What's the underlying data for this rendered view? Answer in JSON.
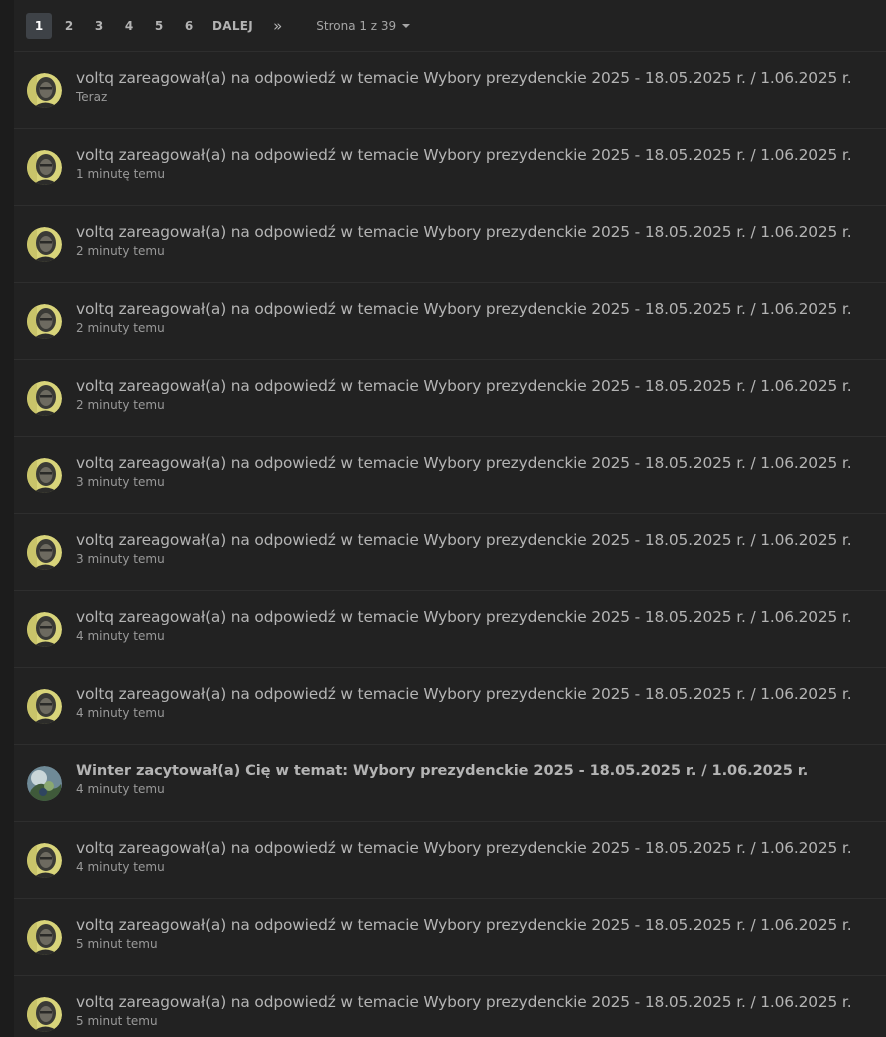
{
  "pagination": {
    "pages": [
      "1",
      "2",
      "3",
      "4",
      "5",
      "6"
    ],
    "active_page": "1",
    "next_label": "DALEJ",
    "last_symbol": "»",
    "page_jump_label": "Strona 1 z 39"
  },
  "notifications": [
    {
      "title": "voltq zareagował(a) na odpowiedź w temacie Wybory prezydenckie 2025 - 18.05.2025 r. / 1.06.2025 r.",
      "time": "Teraz",
      "avatar": "voltq",
      "bold": false
    },
    {
      "title": "voltq zareagował(a) na odpowiedź w temacie Wybory prezydenckie 2025 - 18.05.2025 r. / 1.06.2025 r.",
      "time": "1 minutę temu",
      "avatar": "voltq",
      "bold": false
    },
    {
      "title": "voltq zareagował(a) na odpowiedź w temacie Wybory prezydenckie 2025 - 18.05.2025 r. / 1.06.2025 r.",
      "time": "2 minuty temu",
      "avatar": "voltq",
      "bold": false
    },
    {
      "title": "voltq zareagował(a) na odpowiedź w temacie Wybory prezydenckie 2025 - 18.05.2025 r. / 1.06.2025 r.",
      "time": "2 minuty temu",
      "avatar": "voltq",
      "bold": false
    },
    {
      "title": "voltq zareagował(a) na odpowiedź w temacie Wybory prezydenckie 2025 - 18.05.2025 r. / 1.06.2025 r.",
      "time": "2 minuty temu",
      "avatar": "voltq",
      "bold": false
    },
    {
      "title": "voltq zareagował(a) na odpowiedź w temacie Wybory prezydenckie 2025 - 18.05.2025 r. / 1.06.2025 r.",
      "time": "3 minuty temu",
      "avatar": "voltq",
      "bold": false
    },
    {
      "title": "voltq zareagował(a) na odpowiedź w temacie Wybory prezydenckie 2025 - 18.05.2025 r. / 1.06.2025 r.",
      "time": "3 minuty temu",
      "avatar": "voltq",
      "bold": false
    },
    {
      "title": "voltq zareagował(a) na odpowiedź w temacie Wybory prezydenckie 2025 - 18.05.2025 r. / 1.06.2025 r.",
      "time": "4 minuty temu",
      "avatar": "voltq",
      "bold": false
    },
    {
      "title": "voltq zareagował(a) na odpowiedź w temacie Wybory prezydenckie 2025 - 18.05.2025 r. / 1.06.2025 r.",
      "time": "4 minuty temu",
      "avatar": "voltq",
      "bold": false
    },
    {
      "title": "Winter zacytował(a) Cię w temat: Wybory prezydenckie 2025 - 18.05.2025 r. / 1.06.2025 r.",
      "time": "4 minuty temu",
      "avatar": "winter",
      "bold": true
    },
    {
      "title": "voltq zareagował(a) na odpowiedź w temacie Wybory prezydenckie 2025 - 18.05.2025 r. / 1.06.2025 r.",
      "time": "4 minuty temu",
      "avatar": "voltq",
      "bold": false
    },
    {
      "title": "voltq zareagował(a) na odpowiedź w temacie Wybory prezydenckie 2025 - 18.05.2025 r. / 1.06.2025 r.",
      "time": "5 minut temu",
      "avatar": "voltq",
      "bold": false
    },
    {
      "title": "voltq zareagował(a) na odpowiedź w temacie Wybory prezydenckie 2025 - 18.05.2025 r. / 1.06.2025 r.",
      "time": "5 minut temu",
      "avatar": "voltq",
      "bold": false
    }
  ],
  "colors": {
    "background": "#1c1c1c",
    "panel": "#222222",
    "text": "#b4b4b4",
    "muted": "#9a9a9a",
    "active_page": "#3e4247"
  }
}
